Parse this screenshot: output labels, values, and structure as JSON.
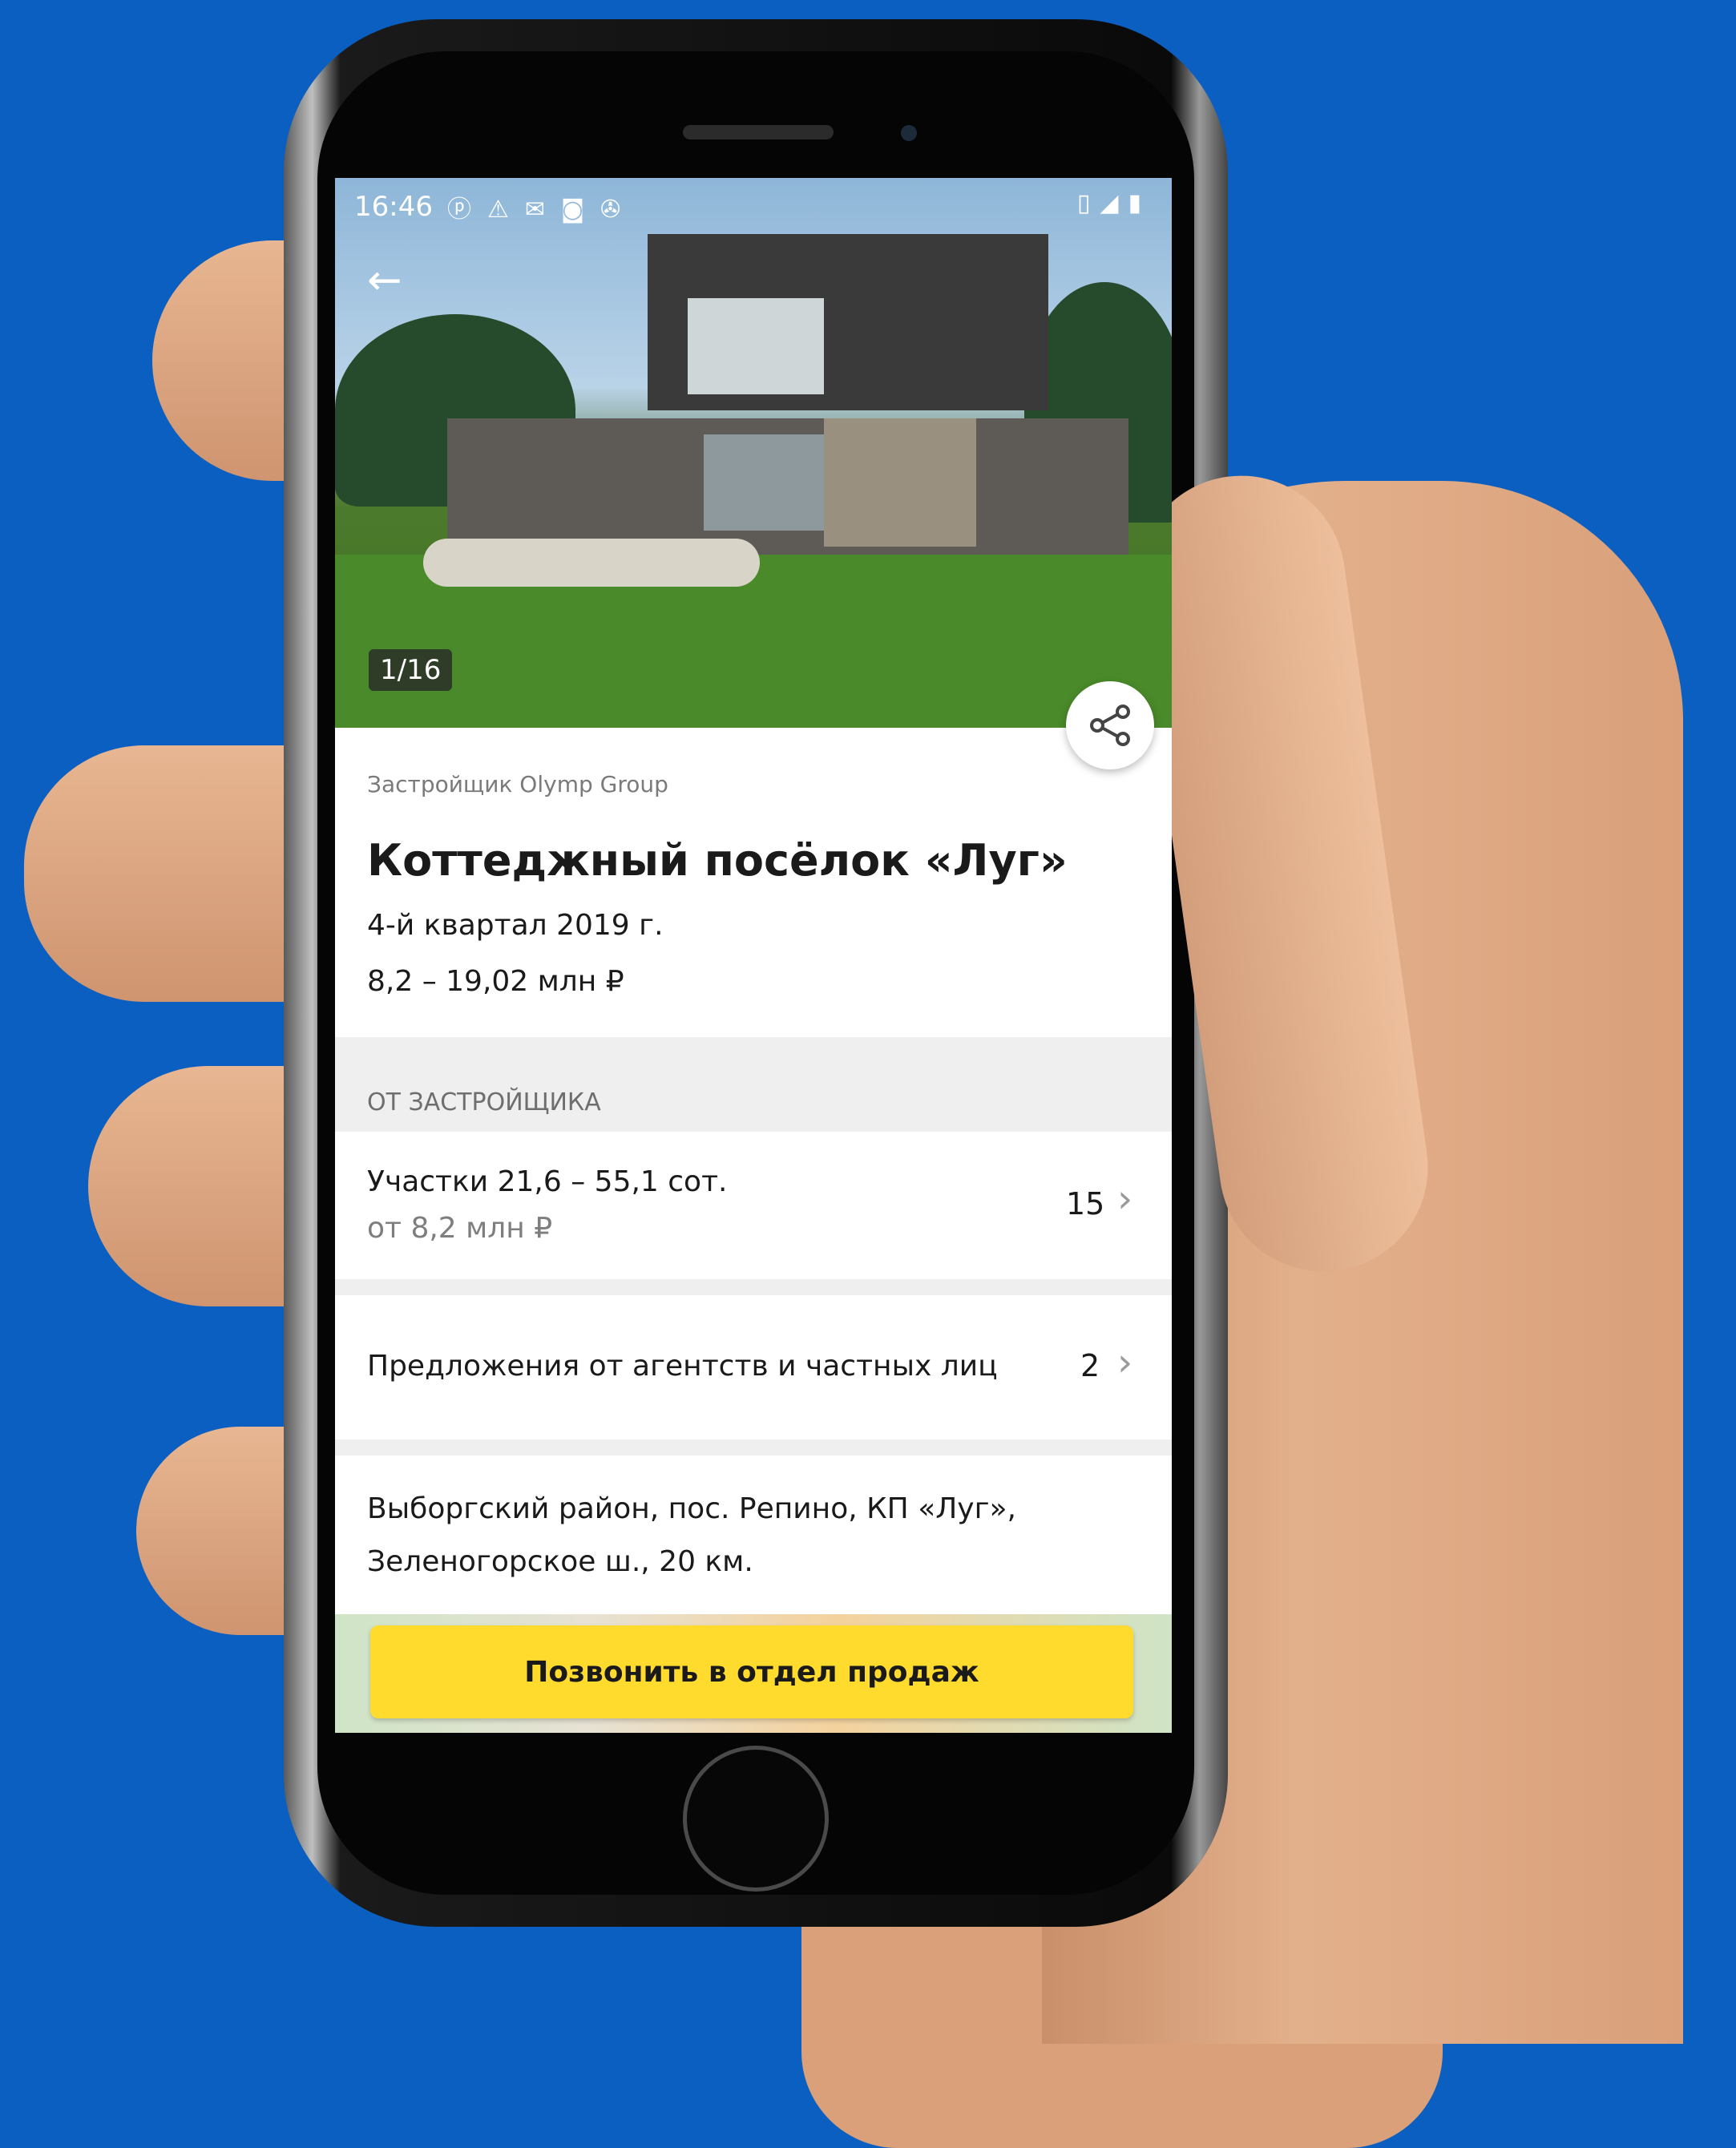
{
  "status_bar": {
    "time": "16:46"
  },
  "gallery": {
    "counter": "1/16"
  },
  "listing": {
    "developer": "Застройщик Olymp Group",
    "title": "Коттеджный посёлок «Луг»",
    "completion": "4-й квартал 2019 г.",
    "price_range": "8,2 – 19,02 млн ₽"
  },
  "developer_section": {
    "label": "ОТ ЗАСТРОЙЩИКА",
    "plots_title": "Участки 21,6 – 55,1 сот.",
    "plots_price": "от 8,2 млн ₽",
    "plots_count": "15"
  },
  "offers": {
    "label": "Предложения от агентств и частных лиц",
    "count": "2"
  },
  "address": {
    "line1": "Выборгский район, пос. Репино, КП «Луг»,",
    "line2": "Зеленогорское ш., 20 км."
  },
  "call_button": {
    "label": "Позвонить в отдел продаж"
  },
  "colors": {
    "background": "#0a5fc0",
    "call_button": "#ffdb2e"
  }
}
